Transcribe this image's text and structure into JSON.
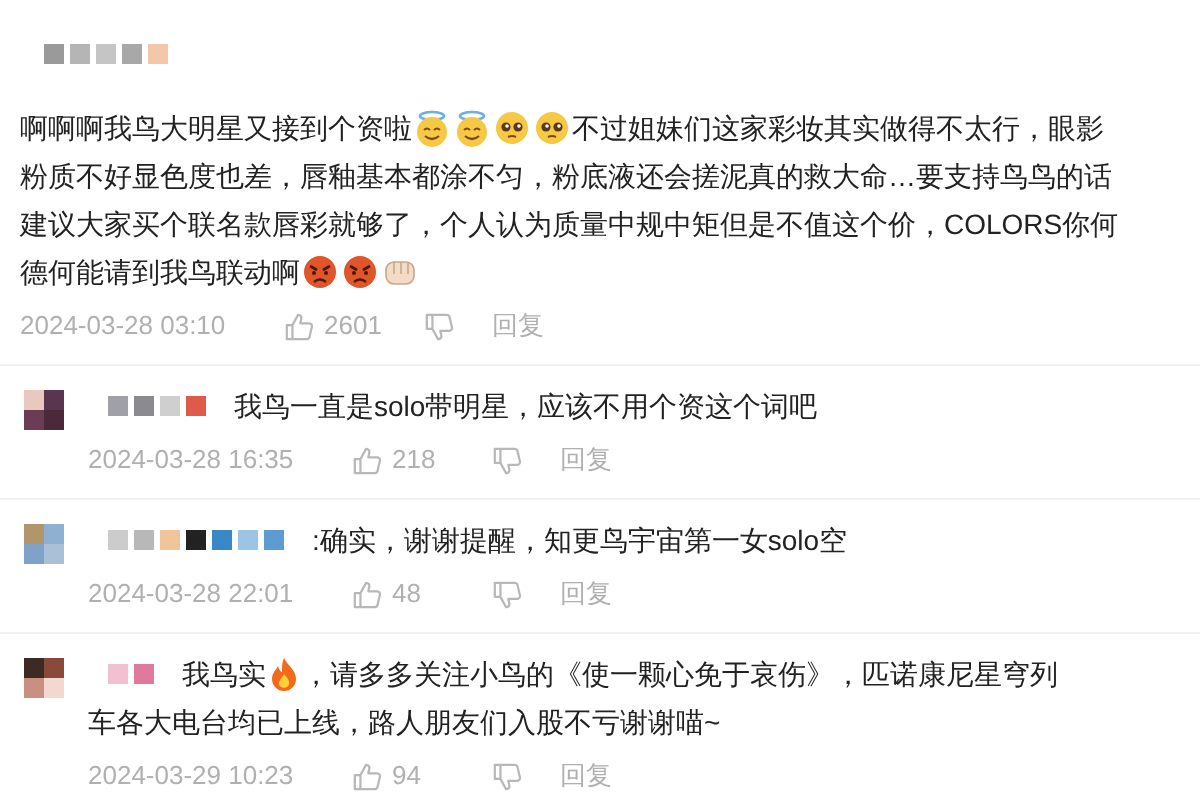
{
  "comments": [
    {
      "kind": "top",
      "lines": [
        [
          {
            "kind": "text",
            "text": "啊啊啊我鸟大明星又接到个资啦"
          },
          {
            "kind": "halo"
          },
          {
            "kind": "halo"
          },
          {
            "kind": "pleading"
          },
          {
            "kind": "pleading"
          },
          {
            "kind": "text",
            "text": "不过姐妹们这家彩妆其实做得不太行，眼影"
          }
        ],
        [
          {
            "kind": "text",
            "text": "粉质不好显色度也差，唇釉基本都涂不匀，粉底液还会搓泥真的救大命…要支持鸟鸟的话"
          }
        ],
        [
          {
            "kind": "text",
            "text": "建议大家买个联名款唇彩就够了，个人认为质量中规中矩但是不值这个价，COLORS你何"
          }
        ],
        [
          {
            "kind": "text",
            "text": "德何能请到我鸟联动啊"
          },
          {
            "kind": "angry"
          },
          {
            "kind": "angry"
          },
          {
            "kind": "fist"
          }
        ]
      ],
      "time": "2024-03-28 03:10",
      "likes": "2601",
      "reply_label": "回复"
    },
    {
      "kind": "reply",
      "lines": [
        [
          {
            "kind": "text",
            "text": "我鸟一直是solo带明星，应该不用个资这个词吧"
          }
        ]
      ],
      "time": "2024-03-28 16:35",
      "likes": "218",
      "reply_label": "回复"
    },
    {
      "kind": "reply",
      "lines": [
        [
          {
            "kind": "text",
            "text": ":确实，谢谢提醒，知更鸟宇宙第一女solo空"
          }
        ]
      ],
      "time": "2024-03-28 22:01",
      "likes": "48",
      "reply_label": "回复"
    },
    {
      "kind": "reply",
      "lines": [
        [
          {
            "kind": "text",
            "text": "我鸟实"
          },
          {
            "kind": "fire"
          },
          {
            "kind": "text",
            "text": "，请多多关注小鸟的《使一颗心免于哀伤》，匹诺康尼星穹列"
          }
        ],
        [
          {
            "kind": "text",
            "text": "车各大电台均已上线，路人朋友们入股不亏谢谢喵~"
          }
        ]
      ],
      "time": "2024-03-29 10:23",
      "likes": "94",
      "reply_label": "回复"
    }
  ]
}
